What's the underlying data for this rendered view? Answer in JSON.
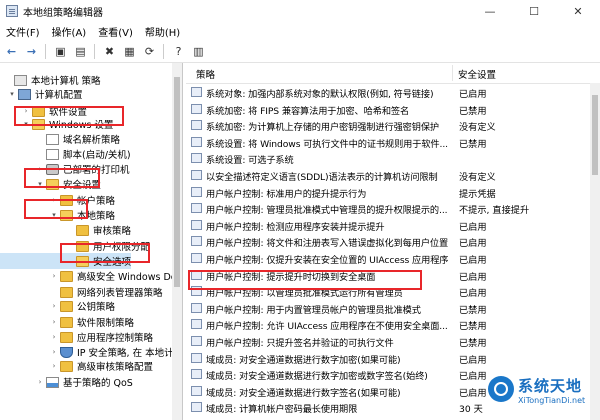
{
  "window": {
    "title": "本地组策略编辑器",
    "controls": [
      "—",
      "☐",
      "✕"
    ]
  },
  "menu": [
    "文件(F)",
    "操作(A)",
    "查看(V)",
    "帮助(H)"
  ],
  "toolbar": [
    "back-arrow-icon",
    "forward-arrow-icon",
    "up-folder-icon",
    "show-hide-tree-icon",
    "delete-icon",
    "properties-icon",
    "refresh-icon",
    "help-icon",
    "filter-icon"
  ],
  "tree": [
    {
      "label": "本地计算机 策略",
      "level": 0,
      "icon": "policy",
      "twisty": ""
    },
    {
      "label": "计算机配置",
      "level": 1,
      "icon": "computer",
      "twisty": "▾"
    },
    {
      "label": "软件设置",
      "level": 2,
      "icon": "folder",
      "twisty": "›"
    },
    {
      "label": "Windows 设置",
      "level": 2,
      "icon": "folder-open",
      "twisty": "▾"
    },
    {
      "label": "域名解析策略",
      "level": 3,
      "icon": "doc",
      "twisty": ""
    },
    {
      "label": "脚本(启动/关机)",
      "level": 3,
      "icon": "doc",
      "twisty": ""
    },
    {
      "label": "已部署的打印机",
      "level": 3,
      "icon": "printer",
      "twisty": "›"
    },
    {
      "label": "安全设置",
      "level": 3,
      "icon": "folder-open",
      "twisty": "▾"
    },
    {
      "label": "帐户策略",
      "level": 4,
      "icon": "folder",
      "twisty": "›"
    },
    {
      "label": "本地策略",
      "level": 4,
      "icon": "folder-open",
      "twisty": "▾"
    },
    {
      "label": "审核策略",
      "level": 5,
      "icon": "folder",
      "twisty": ""
    },
    {
      "label": "用户权限分配",
      "level": 5,
      "icon": "folder",
      "twisty": ""
    },
    {
      "label": "安全选项",
      "level": 5,
      "icon": "folder-open",
      "twisty": "",
      "selected": true
    },
    {
      "label": "高级安全 Windows De",
      "level": 4,
      "icon": "folder",
      "twisty": "›"
    },
    {
      "label": "网络列表管理器策略",
      "level": 4,
      "icon": "folder",
      "twisty": ""
    },
    {
      "label": "公钥策略",
      "level": 4,
      "icon": "folder",
      "twisty": "›"
    },
    {
      "label": "软件限制策略",
      "level": 4,
      "icon": "folder",
      "twisty": "›"
    },
    {
      "label": "应用程序控制策略",
      "level": 4,
      "icon": "folder",
      "twisty": "›"
    },
    {
      "label": "IP 安全策略, 在 本地计",
      "level": 4,
      "icon": "shield",
      "twisty": "›"
    },
    {
      "label": "高级审核策略配置",
      "level": 4,
      "icon": "folder",
      "twisty": "›"
    },
    {
      "label": "基于策略的 QoS",
      "level": 3,
      "icon": "chart",
      "twisty": "›"
    }
  ],
  "columns": {
    "policy": "策略",
    "setting": "安全设置"
  },
  "policies": [
    {
      "name": "系统对象: 加强内部系统对象的默认权限(例如, 符号链接)",
      "setting": "已启用"
    },
    {
      "name": "系统加密: 将 FIPS 兼容算法用于加密、哈希和签名",
      "setting": "已禁用"
    },
    {
      "name": "系统加密: 为计算机上存储的用户密钥强制进行强密钥保护",
      "setting": "没有定义"
    },
    {
      "name": "系统设置: 将 Windows 可执行文件中的证书规则用于软件...",
      "setting": "已禁用"
    },
    {
      "name": "系统设置: 可选子系统",
      "setting": ""
    },
    {
      "name": "以安全描述符定义语言(SDDL)语法表示的计算机访问限制",
      "setting": "没有定义"
    },
    {
      "name": "用户帐户控制: 标准用户的提升提示行为",
      "setting": "提示凭据"
    },
    {
      "name": "用户帐户控制: 管理员批准模式中管理员的提升权限提示的...",
      "setting": "不提示, 直接提升"
    },
    {
      "name": "用户帐户控制: 检测应用程序安装并提示提升",
      "setting": "已启用"
    },
    {
      "name": "用户帐户控制: 将文件和注册表写入错误虚拟化到每用户位置",
      "setting": "已启用"
    },
    {
      "name": "用户帐户控制: 仅提升安装在安全位置的 UIAccess 应用程序",
      "setting": "已启用"
    },
    {
      "name": "用户帐户控制: 提示提升时切换到安全桌面",
      "setting": "已启用"
    },
    {
      "name": "用户帐户控制: 以管理员批准模式运行所有管理员",
      "setting": "已启用"
    },
    {
      "name": "用户帐户控制: 用于内置管理员帐户的管理员批准模式",
      "setting": "已禁用"
    },
    {
      "name": "用户帐户控制: 允许 UIAccess 应用程序在不使用安全桌面...",
      "setting": "已禁用"
    },
    {
      "name": "用户帐户控制: 只提升签名并验证的可执行文件",
      "setting": "已禁用"
    },
    {
      "name": "域成员: 对安全通道数据进行数字加密(如果可能)",
      "setting": "已启用"
    },
    {
      "name": "域成员: 对安全通道数据进行数字加密或数字签名(始终)",
      "setting": "已启用"
    },
    {
      "name": "域成员: 对安全通道数据进行数字签名(如果可能)",
      "setting": "已启用"
    },
    {
      "name": "域成员: 计算机帐户密码最长使用期限",
      "setting": "30 天"
    }
  ],
  "watermark": {
    "cn": "系统天地",
    "en": "XiTongTianDi.net"
  },
  "highlight_color": "#e8262a"
}
